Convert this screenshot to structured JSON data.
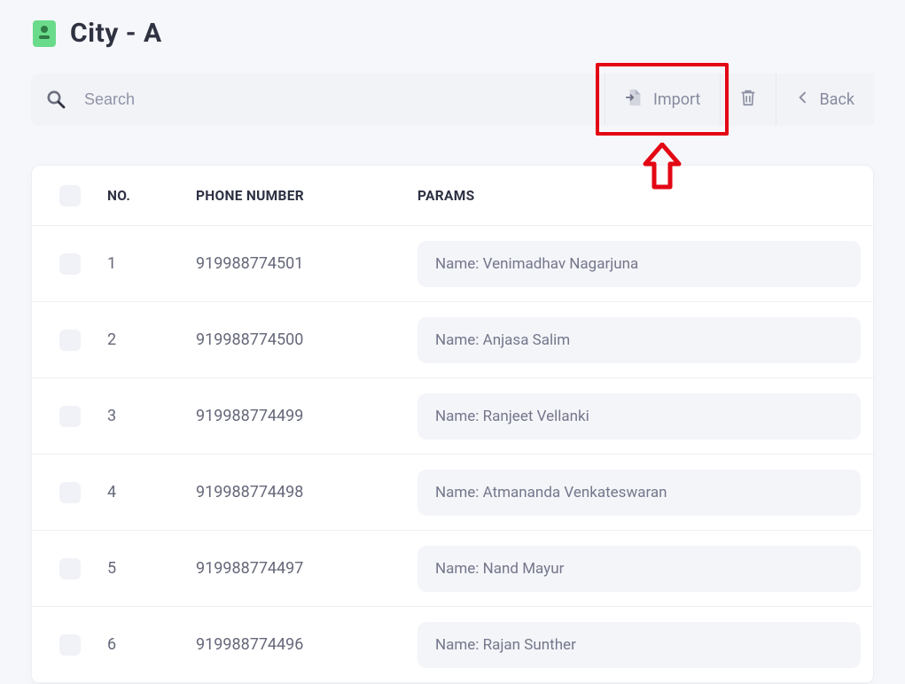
{
  "header": {
    "title": "City - A"
  },
  "toolbar": {
    "search_placeholder": "Search",
    "import_label": "Import",
    "back_label": "Back"
  },
  "table": {
    "columns": {
      "no": "NO.",
      "phone": "PHONE NUMBER",
      "params": "PARAMS"
    },
    "rows": [
      {
        "no": "1",
        "phone": "919988774501",
        "params": "Name: Venimadhav Nagarjuna"
      },
      {
        "no": "2",
        "phone": "919988774500",
        "params": "Name: Anjasa Salim"
      },
      {
        "no": "3",
        "phone": "919988774499",
        "params": "Name: Ranjeet Vellanki"
      },
      {
        "no": "4",
        "phone": "919988774498",
        "params": "Name: Atmananda Venkateswaran"
      },
      {
        "no": "5",
        "phone": "919988774497",
        "params": "Name: Nand Mayur"
      },
      {
        "no": "6",
        "phone": "919988774496",
        "params": "Name: Rajan Sunther"
      }
    ]
  },
  "annotation": {
    "highlight_color": "#e30613"
  }
}
